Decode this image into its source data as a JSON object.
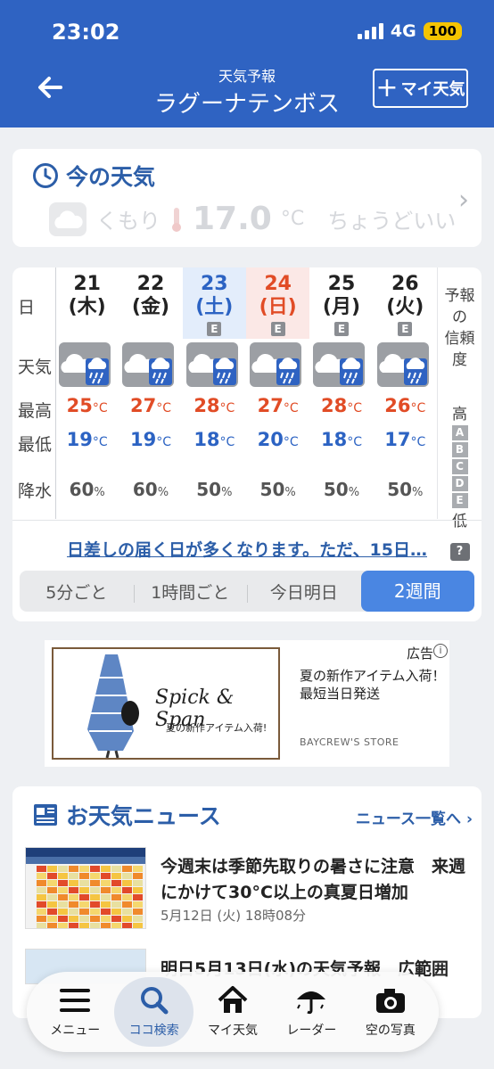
{
  "status": {
    "time": "23:02",
    "network": "4G",
    "battery": "100"
  },
  "header": {
    "subtitle": "天気予報",
    "title": "ラグーナテンボス",
    "my_weather_button": "マイ天気",
    "add_symbol": "+"
  },
  "now": {
    "title": "今の天気",
    "condition": "くもり",
    "temp": "17.0",
    "unit": "°C",
    "feel": "ちょうどいい"
  },
  "forecast": {
    "row_labels": {
      "day": "日",
      "weather": "天気",
      "high": "最高",
      "low": "最低",
      "rain": "降水"
    },
    "days": [
      {
        "date": "21",
        "weekday": "(木)",
        "high": "25",
        "low": "19",
        "rain": "60",
        "badge": "",
        "kind": "weekday"
      },
      {
        "date": "22",
        "weekday": "(金)",
        "high": "27",
        "low": "19",
        "rain": "60",
        "badge": "",
        "kind": "weekday"
      },
      {
        "date": "23",
        "weekday": "(土)",
        "high": "28",
        "low": "18",
        "rain": "50",
        "badge": "E",
        "kind": "sat"
      },
      {
        "date": "24",
        "weekday": "(日)",
        "high": "27",
        "low": "20",
        "rain": "50",
        "badge": "E",
        "kind": "sun"
      },
      {
        "date": "25",
        "weekday": "(月)",
        "high": "28",
        "low": "18",
        "rain": "50",
        "badge": "E",
        "kind": "weekday"
      },
      {
        "date": "26",
        "weekday": "(火)",
        "high": "26",
        "low": "17",
        "rain": "50",
        "badge": "E",
        "kind": "weekday"
      }
    ],
    "temp_unit": "°C",
    "rain_unit": "%",
    "reliability": {
      "title_line1": "予報の",
      "title_line2": "信頼度",
      "high": "高",
      "low": "低",
      "grades": [
        "A",
        "B",
        "C",
        "D",
        "E"
      ],
      "help": "?"
    },
    "summary_link": "日差しの届く日が多くなります。ただ、15日…",
    "tabs": [
      "5分ごと",
      "1時間ごと",
      "今日明日",
      "2週間"
    ],
    "active_tab": "2週間"
  },
  "ad": {
    "label": "広告",
    "brand": "Spick & Span",
    "brand_sub": "夏の新作アイテム入荷!",
    "text_line1": "夏の新作アイテム入荷！",
    "text_line2": "最短当日発送",
    "store": "BAYCREW'S STORE"
  },
  "news": {
    "title": "お天気ニュース",
    "more": "ニュース一覧へ",
    "items": [
      {
        "title": "今週末は季節先取りの暑さに注意　来週にかけて30°C以上の真夏日増加",
        "date": "5月12日 (火) 18時08分"
      },
      {
        "title": "明日5月13日(水)の天気予報　広範囲"
      }
    ]
  },
  "tabbar": {
    "items": [
      {
        "label": "メニュー",
        "icon": "menu-icon"
      },
      {
        "label": "ココ検索",
        "icon": "search-icon"
      },
      {
        "label": "マイ天気",
        "icon": "home-icon"
      },
      {
        "label": "レーダー",
        "icon": "umbrella-icon"
      },
      {
        "label": "空の写真",
        "icon": "camera-icon"
      }
    ],
    "active": "ココ検索"
  },
  "colors": {
    "brand": "#2f63c2",
    "accent": "#4a86e2",
    "high": "#e14c26",
    "low": "#2c63c3"
  }
}
